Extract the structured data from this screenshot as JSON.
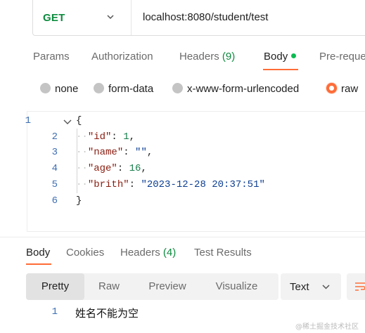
{
  "request": {
    "method": "GET",
    "url": "localhost:8080/student/test"
  },
  "request_tabs": {
    "params": "Params",
    "authorization": "Authorization",
    "headers": "Headers",
    "headers_count": "(9)",
    "body": "Body",
    "prerequest": "Pre-reque"
  },
  "body_types": {
    "none": "none",
    "form_data": "form-data",
    "urlencoded": "x-www-form-urlencoded",
    "raw": "raw",
    "selected": "raw"
  },
  "editor": {
    "line_numbers": [
      "1",
      "2",
      "3",
      "4",
      "5",
      "6"
    ],
    "lines": [
      {
        "open": "{"
      },
      {
        "key": "\"id\"",
        "colon": ": ",
        "value": "1",
        "tail": ","
      },
      {
        "key": "\"name\"",
        "colon": ": ",
        "value": "\"\"",
        "tail": ","
      },
      {
        "key": "\"age\"",
        "colon": ": ",
        "value": "16",
        "tail": ","
      },
      {
        "key": "\"brith\"",
        "colon": ": ",
        "value": "\"2023-12-28 20:37:51\"",
        "tail": ""
      },
      {
        "close": "}"
      }
    ]
  },
  "response_tabs": {
    "body": "Body",
    "cookies": "Cookies",
    "headers": "Headers",
    "headers_count": "(4)",
    "test_results": "Test Results"
  },
  "format": {
    "pretty": "Pretty",
    "raw": "Raw",
    "preview": "Preview",
    "visualize": "Visualize",
    "language": "Text",
    "selected": "Pretty"
  },
  "response": {
    "line_number": "1",
    "text": "姓名不能为空"
  },
  "watermark": "@稀土掘金技术社区",
  "colors": {
    "accent": "#ff6c37",
    "method_get": "#0c8b3e",
    "line_number": "#3e6fb4",
    "json_key": "#8a1c0f",
    "json_string": "#0b3d91",
    "json_number": "#167d4a"
  },
  "icons": [
    "chevron-down-icon",
    "fold-chevron-icon",
    "wrap-lines-icon"
  ]
}
